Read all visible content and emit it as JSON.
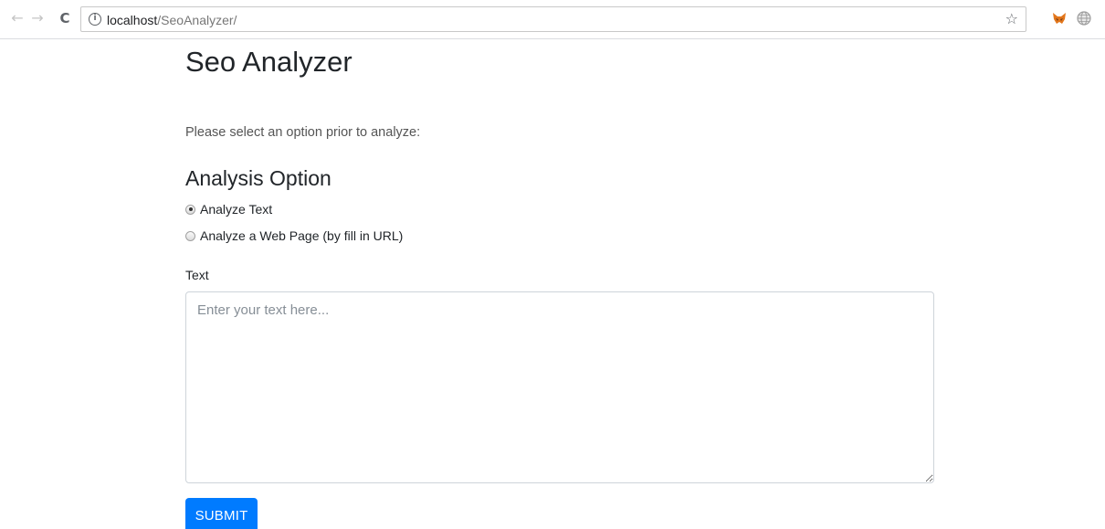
{
  "browser": {
    "url_host": "localhost",
    "url_path": "/SeoAnalyzer/",
    "icons": {
      "back": "arrow-left-icon",
      "forward": "arrow-right-icon",
      "reload": "reload-icon",
      "info": "info-icon",
      "bookmark": "star-icon",
      "extension_1": "fox-extension-icon",
      "extension_2": "globe-extension-icon"
    }
  },
  "page": {
    "title": "Seo Analyzer",
    "intro": "Please select an option prior to analyze:"
  },
  "analysis": {
    "heading": "Analysis Option",
    "options": [
      {
        "label": "Analyze Text",
        "checked": true
      },
      {
        "label": "Analyze a Web Page (by fill in URL)",
        "checked": false
      }
    ]
  },
  "text_field": {
    "label": "Text",
    "placeholder": "Enter your text here...",
    "value": ""
  },
  "submit": {
    "label": "SUBMIT"
  },
  "colors": {
    "primary": "#007bff",
    "text": "#212529",
    "muted": "#555555",
    "input_border": "#ced4da"
  }
}
